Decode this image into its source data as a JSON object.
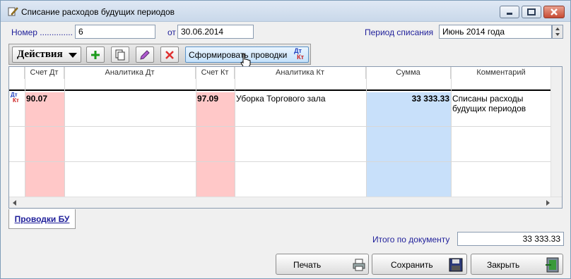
{
  "window": {
    "title": "Списание расходов будущих периодов"
  },
  "header": {
    "number_label": "Номер ..............",
    "number_value": "6",
    "date_label": "от",
    "date_value": "30.06.2014",
    "period_label": "Период списания",
    "period_value": "Июнь 2014 года"
  },
  "toolbar": {
    "actions_label": "Действия",
    "generate_label": "Сформировать проводки",
    "generate_badge_dt": "Дт",
    "generate_badge_kt": "Кт"
  },
  "grid": {
    "columns": [
      "Счет Дт",
      "Аналитика Дт",
      "Счет Кт",
      "Аналитика Кт",
      "Сумма",
      "Комментарий"
    ],
    "row_icon_dt": "Дт",
    "row_icon_kt": "Кт",
    "rows": [
      {
        "debit_account": "90.07",
        "debit_analytics": "",
        "credit_account": "97.09",
        "credit_analytics": "Уборка Торгового зала",
        "amount": "33 333.33",
        "comment_line1": "Списаны расходы",
        "comment_line2": "будущих периодов"
      }
    ]
  },
  "tabs": {
    "postings_bu": "Проводки БУ"
  },
  "totals": {
    "label": "Итого по документу",
    "value": "33 333.33"
  },
  "buttons": {
    "print": "Печать",
    "save": "Сохранить",
    "close": "Закрыть"
  },
  "colors": {
    "account_col": "#ffc8c8",
    "amount_col": "#c8e0fa",
    "label_blue": "#1f1f9a"
  }
}
